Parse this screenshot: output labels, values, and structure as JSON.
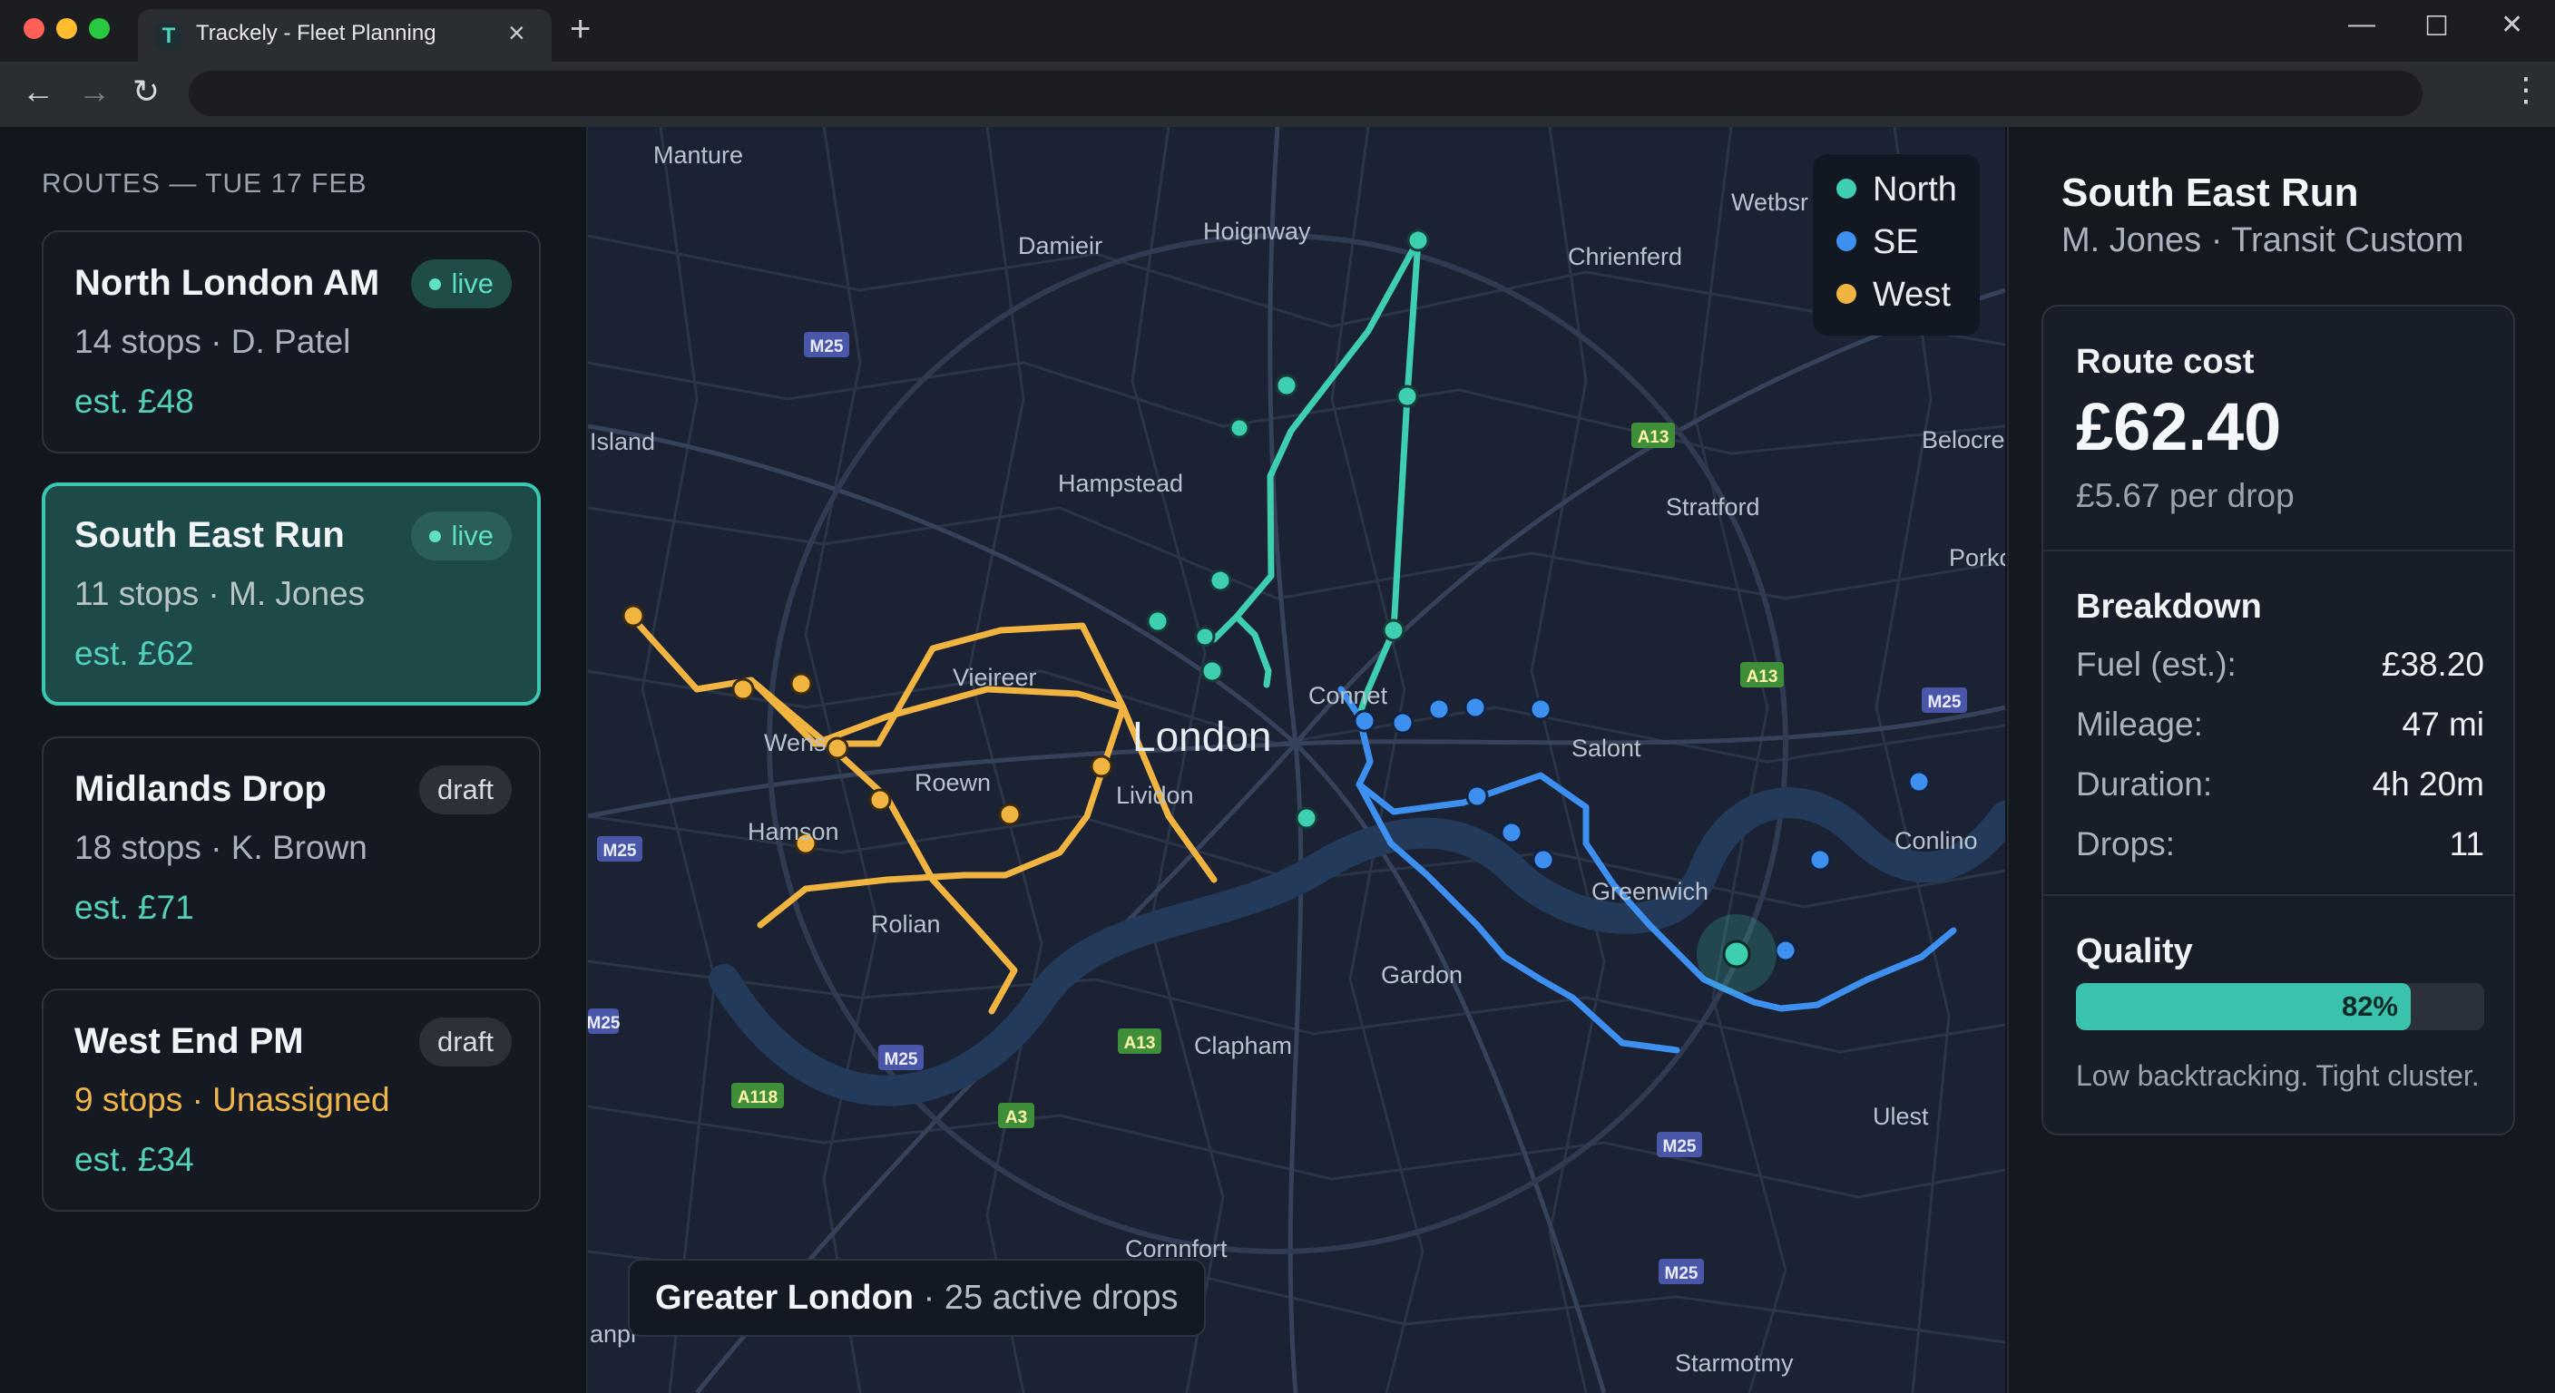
{
  "browser": {
    "tab_title": "Trackely - Fleet Planning",
    "tab_icon_letter": "T"
  },
  "sidebar": {
    "heading": "ROUTES — TUE 17 FEB",
    "routes": [
      {
        "title": "North London AM",
        "subtitle": "14 stops · D. Patel",
        "estimate": "est. £48",
        "status": "live",
        "active": false
      },
      {
        "title": "South East Run",
        "subtitle": "11 stops · M. Jones",
        "estimate": "est. £62",
        "status": "live",
        "active": true
      },
      {
        "title": "Midlands Drop",
        "subtitle": "18 stops · K. Brown",
        "estimate": "est. £71",
        "status": "draft",
        "active": false
      },
      {
        "title": "West End PM",
        "subtitle": "9 stops · Unassigned",
        "estimate": "est. £34",
        "status": "draft",
        "active": false
      }
    ]
  },
  "map": {
    "legend": [
      {
        "label": "North",
        "color": "#3ecfb0"
      },
      {
        "label": "SE",
        "color": "#3d8ff0"
      },
      {
        "label": "West",
        "color": "#f1b440"
      }
    ],
    "caption_place": "Greater London",
    "caption_sep": " · ",
    "caption_detail": "25 active drops",
    "city_label": "London",
    "place_labels": [
      "Manture",
      "Damieir",
      "Hoignway",
      "Chrienferd",
      "Wetbsr",
      "Island",
      "Belocre",
      "Hampstead",
      "Stratford",
      "Porkc",
      "Vieireer",
      "Connet",
      "Wens",
      "Roewn",
      "Lividon",
      "Salont",
      "Hamson",
      "Conlino",
      "Greenwich",
      "Rolian",
      "Gardon",
      "Clapham",
      "Ulest",
      "Cornnfort",
      "Starmotmy",
      "anpr"
    ],
    "road_labels": [
      "M25",
      "A13",
      "A13",
      "M25",
      "M25",
      "M25",
      "M25",
      "A13",
      "A118",
      "M25",
      "A3",
      "M25"
    ]
  },
  "details": {
    "title": "South East Run",
    "subtitle": "M. Jones · Transit Custom",
    "cost_label": "Route cost",
    "cost_value": "£62.40",
    "cost_per_drop": "£5.67 per drop",
    "breakdown_label": "Breakdown",
    "breakdown": [
      {
        "label": "Fuel (est.):",
        "value": "£38.20"
      },
      {
        "label": "Mileage:",
        "value": "47 mi"
      },
      {
        "label": "Duration:",
        "value": "4h 20m"
      },
      {
        "label": "Drops:",
        "value": "11"
      }
    ],
    "quality_label": "Quality",
    "quality_percent": 82,
    "quality_text": "82%",
    "quality_note": "Low backtracking. Tight cluster."
  }
}
